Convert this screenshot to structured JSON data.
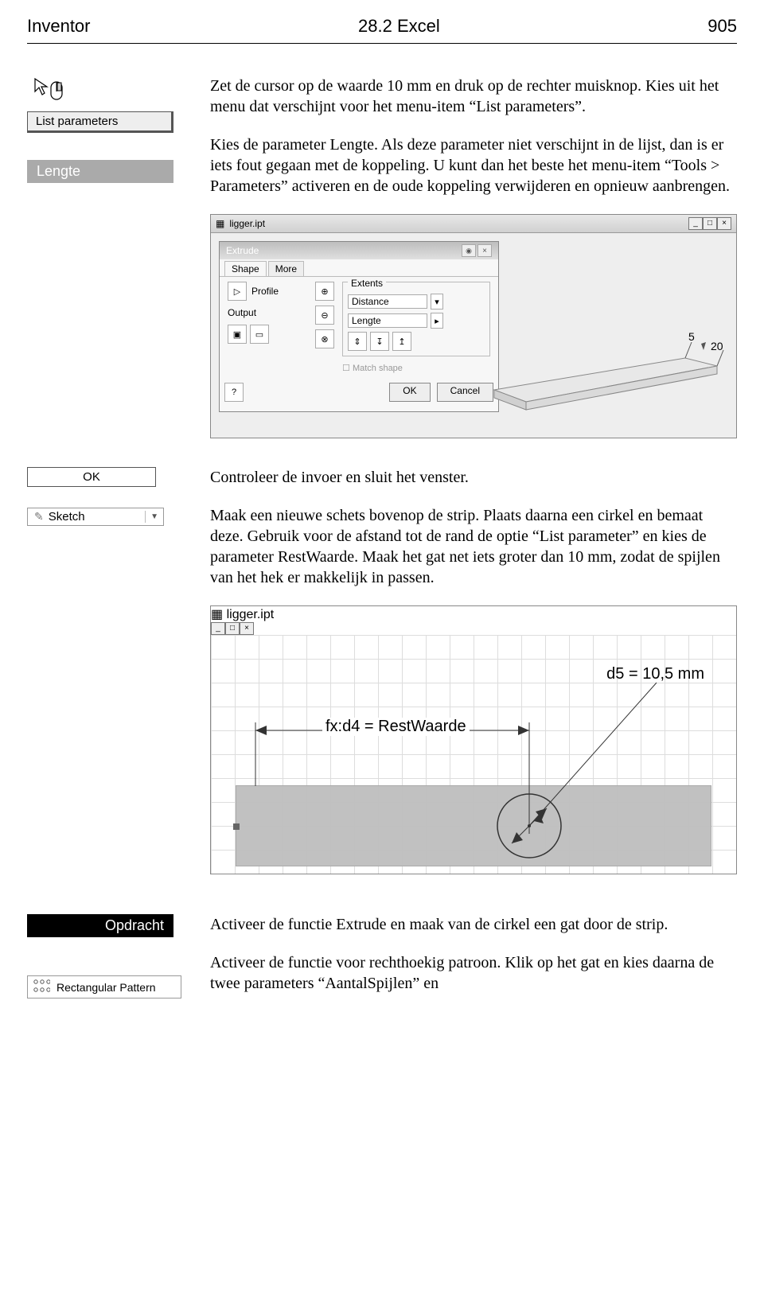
{
  "header": {
    "left": "Inventor",
    "center": "28.2 Excel",
    "right": "905"
  },
  "sidebar": {
    "list_parameters_button": "List parameters",
    "lengte_tag": "Lengte",
    "ok_button": "OK",
    "sketch_button": "Sketch",
    "opdracht_tag": "Opdracht",
    "rect_pattern_button": "Rectangular Pattern"
  },
  "paragraphs": {
    "p1": "Zet de cursor op de waarde 10 mm en druk op de rechter muisknop. Kies uit het menu dat verschijnt voor het menu-item “List parameters”.",
    "p2": "Kies de parameter Lengte. Als deze parameter niet verschijnt in de lijst, dan is er iets fout gegaan met de koppeling. U kunt dan het beste het menu-item “Tools > Parameters” activeren en de oude koppeling verwijderen en opnieuw aanbrengen.",
    "p3": "Controleer de invoer en sluit  het venster.",
    "p4": "Maak een nieuwe schets bovenop de strip. Plaats daarna een cirkel en bemaat deze. Gebruik voor de afstand tot de rand de optie “List parameter” en kies de parameter RestWaarde. Maak het gat net iets groter dan 10 mm, zodat de spijlen van het hek er makkelijk in passen.",
    "p5": "Activeer de functie Extrude en maak van de cirkel een gat door de strip.",
    "p6": "Activeer de functie voor rechthoekig patroon. Klik op het gat en kies daarna de twee parameters “AantalSpijlen” en"
  },
  "extrude_win": {
    "file_title": "ligger.ipt",
    "dlg_title": "Extrude",
    "tab_shape": "Shape",
    "tab_more": "More",
    "profile_label": "Profile",
    "output_label": "Output",
    "extents_label": "Extents",
    "distance_option": "Distance",
    "lengte_value": "Lengte",
    "match_shape": "Match shape",
    "ok": "OK",
    "cancel": "Cancel",
    "dim_text": "5",
    "dim_text2": "20"
  },
  "sketch_win": {
    "file_title": "ligger.ipt",
    "dim_d5": "d5 = 10,5 mm",
    "dim_fx": "fx:d4 = RestWaarde"
  }
}
